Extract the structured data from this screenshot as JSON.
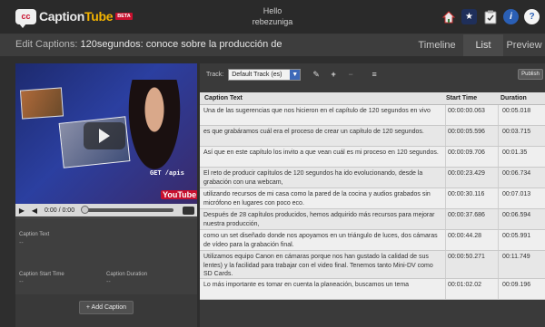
{
  "header": {
    "logo_text_1": "Caption",
    "logo_text_2": "Tube",
    "logo_badge": "BETA",
    "logo_bubble": "cc",
    "greeting": "Hello",
    "username": "rebezuniga",
    "icons": [
      "home-icon",
      "star-icon",
      "clipboard-icon",
      "info-icon",
      "help-icon"
    ]
  },
  "titlebar": {
    "prefix": "Edit Captions:",
    "video_title": "120segundos: conoce sobre la producción de",
    "tabs": [
      {
        "label": "Timeline",
        "active": false
      },
      {
        "label": "List",
        "active": true
      },
      {
        "label": "Preview",
        "active": false
      }
    ]
  },
  "video": {
    "overlay_text": "GET  /apis",
    "watermark": "YouTube",
    "time": "0:00 / 0:00",
    "progress": 0
  },
  "fields": {
    "caption_text_label": "Caption Text",
    "caption_text_value": "--",
    "start_time_label": "Caption Start Time",
    "start_time_value": "--",
    "duration_label": "Caption Duration",
    "duration_value": "--"
  },
  "add_caption_label": "+ Add Caption",
  "toolbar": {
    "track_label": "Track:",
    "track_value": "Default Track (es)",
    "publish_label": "Publish"
  },
  "table": {
    "headers": [
      "Caption Text",
      "Start Time",
      "Duration"
    ],
    "rows": [
      {
        "text": "Una de las sugerencias que nos hicieron en el capítulo de 120 segundos en vivo",
        "start": "00:00:00.063",
        "duration": "00:05.018"
      },
      {
        "text": "es que grabáramos cuál era el proceso de crear un capítulo de 120 segundos.",
        "start": "00:00:05.596",
        "duration": "00:03.715"
      },
      {
        "text": "Así que en este capítulo los invito a que vean cuál es mi proceso en 120 segundos.",
        "start": "00:00:09.706",
        "duration": "00:01.35"
      },
      {
        "text": "El reto de producir capítulos de 120 segundos ha ido evolucionando, desde la grabación con una webcam,",
        "start": "00:00:23.429",
        "duration": "00:06.734"
      },
      {
        "text": "utilizando recursos de mi casa como la pared de la cocina y audios grabados sin micrófono en lugares con poco eco.",
        "start": "00:00:30.116",
        "duration": "00:07.013"
      },
      {
        "text": "Después de 28 capítulos producidos, hemos adquirido más recursos para mejorar nuestra producción,",
        "start": "00:00:37.686",
        "duration": "00:06.594"
      },
      {
        "text": "como un set diseñado donde nos apoyamos en un triángulo de luces, dos cámaras de vídeo para la grabación final.",
        "start": "00:00:44.28",
        "duration": "00:05.991"
      },
      {
        "text": "Utilizamos equipo Canon en cámaras porque nos han gustado la calidad de sus lentes) y la facilidad para trabajar con el video final. Tenemos tanto Mini-DV como SD Cards.",
        "start": "00:00:50.271",
        "duration": "00:11.749"
      },
      {
        "text": "Lo más importante es tomar en cuenta la planeación, buscamos un tema",
        "start": "00:01:02.02",
        "duration": "00:09.196"
      }
    ]
  }
}
